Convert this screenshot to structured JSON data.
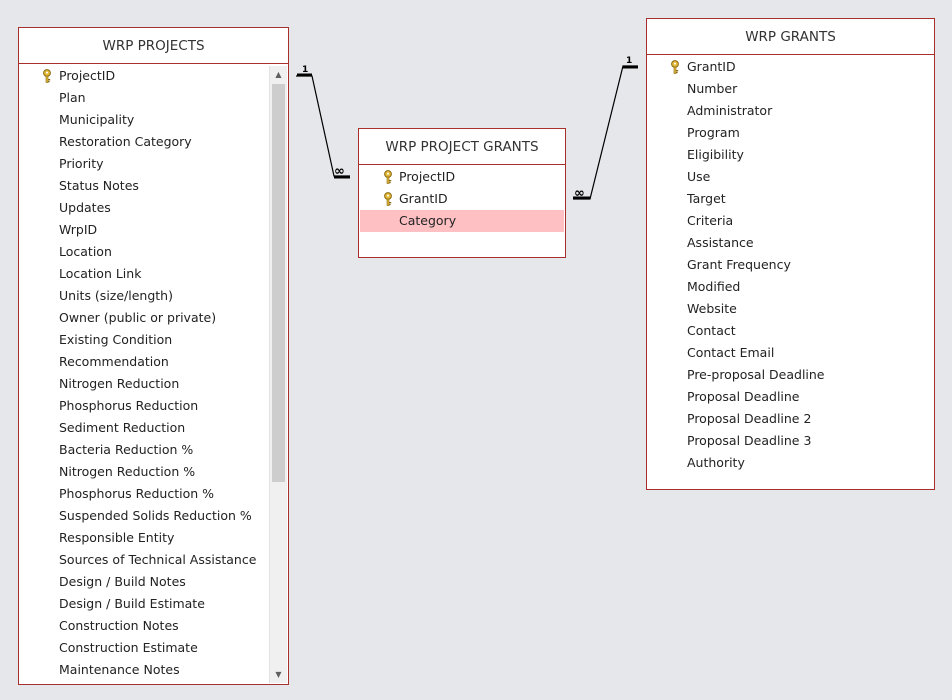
{
  "projects": {
    "title": "WRP PROJECTS",
    "fields": [
      {
        "name": "ProjectID",
        "key": true
      },
      {
        "name": "Plan"
      },
      {
        "name": "Municipality"
      },
      {
        "name": "Restoration Category"
      },
      {
        "name": "Priority"
      },
      {
        "name": "Status Notes"
      },
      {
        "name": "Updates"
      },
      {
        "name": "WrpID"
      },
      {
        "name": "Location"
      },
      {
        "name": "Location Link"
      },
      {
        "name": "Units (size/length)"
      },
      {
        "name": "Owner (public or private)"
      },
      {
        "name": "Existing Condition"
      },
      {
        "name": "Recommendation"
      },
      {
        "name": "Nitrogen Reduction"
      },
      {
        "name": "Phosphorus Reduction"
      },
      {
        "name": "Sediment Reduction"
      },
      {
        "name": "Bacteria Reduction %"
      },
      {
        "name": "Nitrogen Reduction %"
      },
      {
        "name": "Phosphorus Reduction %"
      },
      {
        "name": "Suspended Solids Reduction %"
      },
      {
        "name": "Responsible Entity"
      },
      {
        "name": "Sources of Technical Assistance"
      },
      {
        "name": "Design / Build Notes"
      },
      {
        "name": "Design / Build Estimate"
      },
      {
        "name": "Construction  Notes"
      },
      {
        "name": "Construction Estimate"
      },
      {
        "name": "Maintenance Notes"
      }
    ],
    "scroll_up": "▲",
    "scroll_down": "▼"
  },
  "project_grants": {
    "title": "WRP PROJECT GRANTS",
    "fields": [
      {
        "name": "ProjectID",
        "key": true
      },
      {
        "name": "GrantID",
        "key": true
      },
      {
        "name": "Category",
        "selected": true
      }
    ]
  },
  "grants": {
    "title": "WRP GRANTS",
    "fields": [
      {
        "name": "GrantID",
        "key": true
      },
      {
        "name": "Number"
      },
      {
        "name": "Administrator"
      },
      {
        "name": "Program"
      },
      {
        "name": "Eligibility"
      },
      {
        "name": "Use"
      },
      {
        "name": "Target"
      },
      {
        "name": "Criteria"
      },
      {
        "name": "Assistance"
      },
      {
        "name": "Grant Frequency"
      },
      {
        "name": "Modified"
      },
      {
        "name": "Website"
      },
      {
        "name": "Contact"
      },
      {
        "name": "Contact Email"
      },
      {
        "name": "Pre-proposal Deadline"
      },
      {
        "name": "Proposal Deadline"
      },
      {
        "name": "Proposal Deadline 2"
      },
      {
        "name": "Proposal Deadline 3"
      },
      {
        "name": "Authority"
      }
    ]
  },
  "relationships": [
    {
      "from": "WRP PROJECTS.ProjectID",
      "to": "WRP PROJECT GRANTS.ProjectID",
      "one_label": "1",
      "many_label": "∞"
    },
    {
      "from": "WRP GRANTS.GrantID",
      "to": "WRP PROJECT GRANTS.GrantID",
      "one_label": "1",
      "many_label": "∞"
    }
  ],
  "colors": {
    "border": "#a8302c",
    "selected_row": "#ffc0c4",
    "key_icon": "#c9a227",
    "background": "#e6e7ea"
  }
}
